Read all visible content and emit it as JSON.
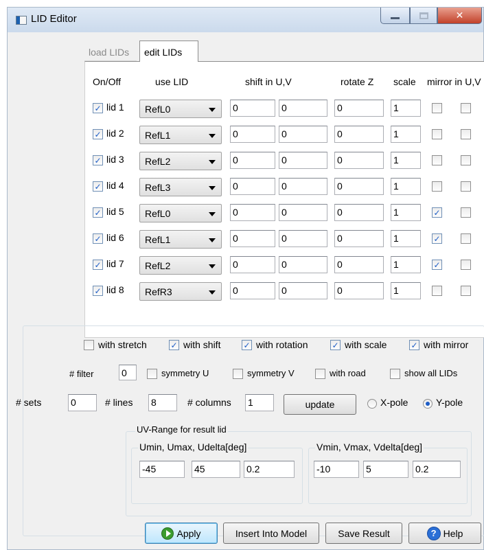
{
  "window": {
    "title": "LID Editor"
  },
  "tabs": [
    {
      "label": "load LIDs",
      "active": false
    },
    {
      "label": "edit LIDs",
      "active": true
    }
  ],
  "columns": {
    "onoff": "On/Off",
    "use_lid": "use LID",
    "shift": "shift in U,V",
    "rotate": "rotate Z",
    "scale": "scale",
    "mirror": "mirror in U,V"
  },
  "lids": [
    {
      "label": "lid 1",
      "on": true,
      "use": "RefL0",
      "shift_u": "0",
      "shift_v": "0",
      "rotate": "0",
      "scale": "1",
      "mirror_u": false,
      "mirror_v": false
    },
    {
      "label": "lid 2",
      "on": true,
      "use": "RefL1",
      "shift_u": "0",
      "shift_v": "0",
      "rotate": "0",
      "scale": "1",
      "mirror_u": false,
      "mirror_v": false
    },
    {
      "label": "lid 3",
      "on": true,
      "use": "RefL2",
      "shift_u": "0",
      "shift_v": "0",
      "rotate": "0",
      "scale": "1",
      "mirror_u": false,
      "mirror_v": false
    },
    {
      "label": "lid 4",
      "on": true,
      "use": "RefL3",
      "shift_u": "0",
      "shift_v": "0",
      "rotate": "0",
      "scale": "1",
      "mirror_u": false,
      "mirror_v": false
    },
    {
      "label": "lid 5",
      "on": true,
      "use": "RefL0",
      "shift_u": "0",
      "shift_v": "0",
      "rotate": "0",
      "scale": "1",
      "mirror_u": true,
      "mirror_v": false
    },
    {
      "label": "lid 6",
      "on": true,
      "use": "RefL1",
      "shift_u": "0",
      "shift_v": "0",
      "rotate": "0",
      "scale": "1",
      "mirror_u": true,
      "mirror_v": false
    },
    {
      "label": "lid 7",
      "on": true,
      "use": "RefL2",
      "shift_u": "0",
      "shift_v": "0",
      "rotate": "0",
      "scale": "1",
      "mirror_u": true,
      "mirror_v": false
    },
    {
      "label": "lid 8",
      "on": true,
      "use": "RefR3",
      "shift_u": "0",
      "shift_v": "0",
      "rotate": "0",
      "scale": "1",
      "mirror_u": false,
      "mirror_v": false
    }
  ],
  "options": {
    "with_stretch": {
      "label": "with stretch",
      "checked": false
    },
    "with_shift": {
      "label": "with shift",
      "checked": true
    },
    "with_rotation": {
      "label": "with rotation",
      "checked": true
    },
    "with_scale": {
      "label": "with scale",
      "checked": true
    },
    "with_mirror": {
      "label": "with mirror",
      "checked": true
    },
    "filter_label": "# filter",
    "filter_value": "0",
    "symmetry_u": {
      "label": "symmetry U",
      "checked": false
    },
    "symmetry_v": {
      "label": "symmetry V",
      "checked": false
    },
    "with_road": {
      "label": "with road",
      "checked": false
    },
    "show_all": {
      "label": "show all LIDs",
      "checked": false
    },
    "sets_label": "# sets",
    "sets_value": "0",
    "lines_label": "# lines",
    "lines_value": "8",
    "columns_label": "# columns",
    "columns_value": "1",
    "update_label": "update",
    "xpole": {
      "label": "X-pole",
      "selected": false
    },
    "ypole": {
      "label": "Y-pole",
      "selected": true
    }
  },
  "uv_range": {
    "title": "UV-Range for result lid",
    "u_title": "Umin, Umax, Udelta[deg]",
    "v_title": "Vmin, Vmax, Vdelta[deg]",
    "umin": "-45",
    "umax": "45",
    "udelta": "0.2",
    "vmin": "-10",
    "vmax": "5",
    "vdelta": "0.2"
  },
  "buttons": {
    "apply": "Apply",
    "insert": "Insert Into Model",
    "save": "Save Result",
    "help": "Help"
  },
  "icons": {
    "apply": "play-circle-icon",
    "help": "question-circle-icon"
  }
}
